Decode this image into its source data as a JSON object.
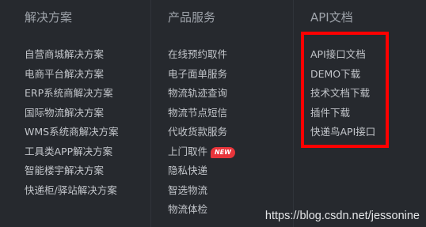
{
  "columns": [
    {
      "title": "解决方案",
      "links": [
        {
          "label": "自营商城解决方案"
        },
        {
          "label": "电商平台解决方案"
        },
        {
          "label": "ERP系统商解决方案"
        },
        {
          "label": "国际物流解决方案"
        },
        {
          "label": "WMS系统商解决方案"
        },
        {
          "label": "工具类APP解决方案"
        },
        {
          "label": "智能楼宇解决方案"
        },
        {
          "label": "快递柜/驿站解决方案"
        }
      ]
    },
    {
      "title": "产品服务",
      "links": [
        {
          "label": "在线预约取件"
        },
        {
          "label": "电子面单服务"
        },
        {
          "label": "物流轨迹查询"
        },
        {
          "label": "物流节点短信"
        },
        {
          "label": "代收货款服务"
        },
        {
          "label": "上门取件",
          "badge": "NEW"
        },
        {
          "label": "隐私快递"
        },
        {
          "label": "智选物流"
        },
        {
          "label": "物流体检"
        }
      ]
    },
    {
      "title": "API文档",
      "links": [
        {
          "label": "API接口文档"
        },
        {
          "label": "DEMO下载"
        },
        {
          "label": "技术文档下载"
        },
        {
          "label": "插件下载"
        },
        {
          "label": "快递鸟API接口"
        }
      ]
    }
  ],
  "watermark": "https://blog.csdn.net/jessonine",
  "colors": {
    "background": "#26292e",
    "highlight": "#ff0000",
    "badge": "#e8353b"
  }
}
